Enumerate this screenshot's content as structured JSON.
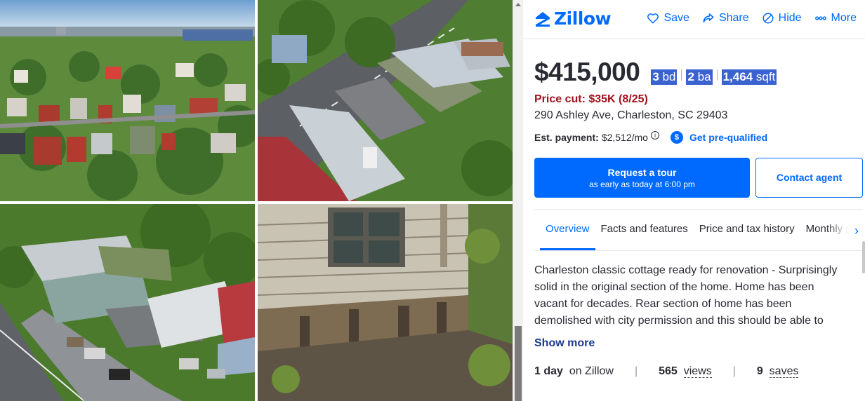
{
  "gallery": {
    "photos": [
      {
        "name": "aerial-neighborhood-photo"
      },
      {
        "name": "aerial-rooftops-photo"
      },
      {
        "name": "aerial-street-corner-photo"
      },
      {
        "name": "weathered-siding-foundation-photo"
      }
    ]
  },
  "header": {
    "logo": "Zillow",
    "actions": [
      {
        "label": "Save",
        "icon": "heart-icon"
      },
      {
        "label": "Share",
        "icon": "share-icon"
      },
      {
        "label": "Hide",
        "icon": "hide-icon"
      },
      {
        "label": "More",
        "icon": "more-icon"
      }
    ]
  },
  "listing": {
    "price": "$415,000",
    "beds_num": "3",
    "beds_unit": "bd",
    "baths_num": "2",
    "baths_unit": "ba",
    "sqft_num": "1,464",
    "sqft_unit": "sqft",
    "price_cut": "Price cut: $35K (8/25)",
    "address": "290 Ashley Ave, Charleston, SC 29403",
    "payment_label": "Est. payment:",
    "payment_value": "$2,512/mo",
    "prequalified": "Get pre-qualified"
  },
  "buttons": {
    "tour_title": "Request a tour",
    "tour_sub": "as early as today at 6:00 pm",
    "contact": "Contact agent"
  },
  "tabs": [
    "Overview",
    "Facts and features",
    "Price and tax history",
    "Monthly payment calculator"
  ],
  "description": "Charleston classic cottage ready for renovation - Surprisingly solid in the original section of the home. Home has been vacant for decades. Rear section of home has been demolished with city permission and this should be able to",
  "show_more": "Show more",
  "stats": {
    "days_value": "1 day",
    "days_label": "on Zillow",
    "views_value": "565",
    "views_label": "views",
    "saves_value": "9",
    "saves_label": "saves",
    "separator": "|"
  },
  "colors": {
    "brand": "#006aff",
    "price_cut": "#a1111d",
    "fact_highlight": "#3b63d0"
  }
}
